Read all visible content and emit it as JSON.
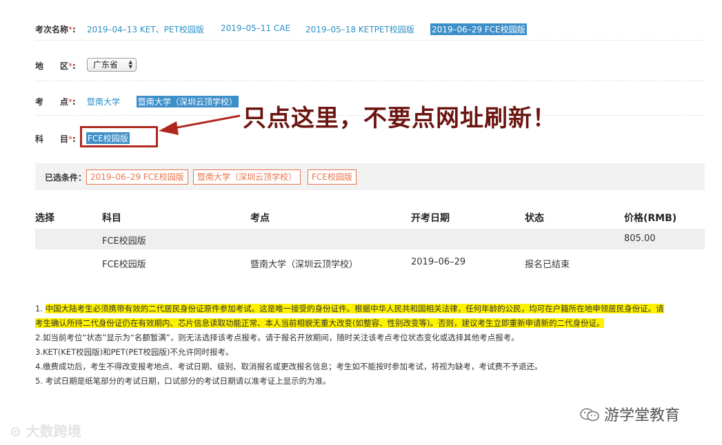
{
  "exam": {
    "label": "考次名称",
    "required_mark": "*",
    "options": [
      "2019–04–13 KET、PET校园版",
      "2019–05–11 CAE",
      "2019–05–18 KETPET校园版",
      "2019–06–29 FCE校园版"
    ]
  },
  "region": {
    "label": "地　　区",
    "required_mark": "*",
    "selected": "广东省",
    "arrows": "▲▼"
  },
  "venue": {
    "label": "考　　点",
    "required_mark": "*",
    "options": [
      "暨南大学",
      "暨南大学（深圳云顶学校）"
    ]
  },
  "subject": {
    "label": "科　　目",
    "required_mark": "*",
    "options": [
      "FCE校园版"
    ]
  },
  "annotation": {
    "text": "只点这里，不要点网址刷新！",
    "color": "#6b1410"
  },
  "filters": {
    "label": "已选条件：",
    "chips": [
      "2019–06–29 FCE校园版",
      "暨南大学（深圳云顶学校）",
      "FCE校园版"
    ]
  },
  "table": {
    "headers": [
      "选择",
      "科目",
      "考点",
      "开考日期",
      "状态",
      "价格(RMB)"
    ],
    "rows": [
      {
        "subject": "FCE校园版",
        "venue": "",
        "date": "",
        "status": "",
        "price": "805.00"
      },
      {
        "subject": "FCE校园版",
        "venue": "暨南大学（深圳云顶学校）",
        "date": "2019–06–29",
        "status": "报名已结束",
        "price": ""
      }
    ]
  },
  "notes": {
    "n1_prefix": "1.  ",
    "n1_line1": "中国大陆考生必须携带有效的二代居民身份证原件参加考试。这是唯一接受的身份证件。根据中华人民共和国相关法律，任何年龄的公民，均可在户籍所在地申领居民身份证。请",
    "n1_line2": "考生确认所持二代身份证仍在有效期内、芯片信息读取功能正常、本人当前相貌无重大改变(如整容、性别改变等)。否则，建议考生立即重新申请新的二代身份证。",
    "n2": "2.如当前考位“状态”显示为“名额暂满”，则无法选择该考点报考。请于报名开放期间，随时关注该考点考位状态变化或选择其他考点报考。",
    "n3": "3.KET(KET校园版)和PET(PET校园版)不允许同时报考。",
    "n4": "4.缴费成功后，考生不得改变报考地点、考试日期、级别、取消报名或更改报名信息；考生如不能按时参加考试，将视为缺考，考试费不予退还。",
    "n5": "5.   考试日期是纸笔部分的考试日期，口试部分的考试日期请以准考证上显示的为准。"
  },
  "watermarks": {
    "left": "大数跨境",
    "right": "游学堂教育"
  },
  "colors": {
    "link": "#2a8fc6",
    "selected_bg": "#3d8fc9",
    "chip": "#e8744a",
    "highlight": "#fff200",
    "required": "#e53935",
    "annotation_box": "#b0281d"
  }
}
